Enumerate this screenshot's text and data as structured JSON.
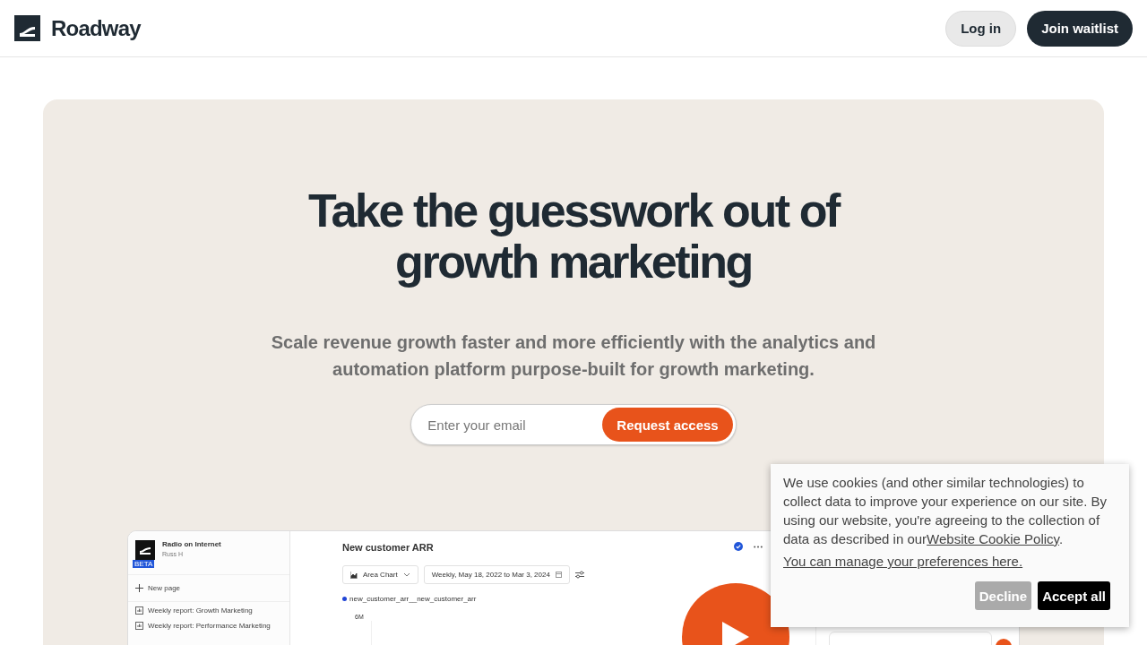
{
  "header": {
    "brand": "Roadway",
    "buttons": [
      {
        "label": "Log in",
        "kind": "secondary"
      },
      {
        "label": "Join waitlist",
        "kind": "primary"
      }
    ]
  },
  "hero": {
    "title": "Take the guesswork out of growth marketing",
    "subtitle": "Scale revenue growth faster and more efficiently with the analytics and automation platform purpose-built for growth marketing.",
    "email_placeholder": "Enter your email",
    "submit": "Request access"
  },
  "app_preview": {
    "workspace": "Radio on Internet",
    "user": "Russ H",
    "badge": "BETA",
    "new_page": "New page",
    "pages": [
      {
        "label": "Weekly report: Growth Marketing"
      },
      {
        "label": "Weekly report: Performance Marketing"
      }
    ],
    "report_title": "New customer ARR",
    "chart_type": "Area Chart",
    "date_range": "Weekly, May 18, 2022 to Mar 3, 2024",
    "legend": "new_customer_arr__new_customer_arr",
    "y_label": "6M"
  },
  "cookie_banner": {
    "text": "We use cookies (and other similar technologies) to collect data to improve your experience on our site. By using our website, you're agreeing to the collection of data as described in our",
    "policy_link": "Website Cookie Policy",
    "text_end": ".",
    "preferences_link": "You can manage your preferences here.",
    "buttons": [
      {
        "label": "Decline",
        "kind": "decline"
      },
      {
        "label": "Accept all",
        "kind": "accept"
      }
    ]
  }
}
